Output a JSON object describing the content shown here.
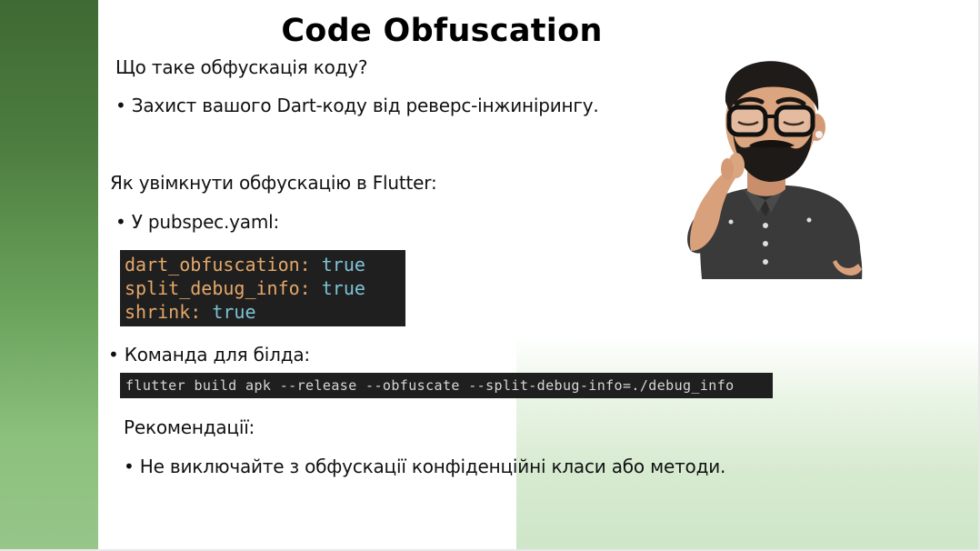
{
  "slide": {
    "title": "Code Obfuscation",
    "question": "Що таке обфускація коду?",
    "bullet_protection": "• Захист вашого Dart-коду від реверс-інжинірингу.",
    "how_to_heading": "Як увімкнути обфускацію в Flutter:",
    "bullet_pubspec": "• У pubspec.yaml:",
    "pubspec_code": [
      {
        "key": "dart_obfuscation:",
        "value": "true"
      },
      {
        "key": "split_debug_info:",
        "value": "true"
      },
      {
        "key": "shrink:",
        "value": "true"
      }
    ],
    "bullet_build_command": "• Команда для білда:",
    "build_command": "flutter build apk --release --obfuscate --split-debug-info=./debug_info",
    "recommendations_heading": "Рекомендації:",
    "bullet_recommendation": "• Не виключайте з обфускації конфіденційні класи або методи."
  },
  "colors": {
    "band_dark": "#3f6a33",
    "band_light": "#96c689",
    "code_bg": "#1f1f1f",
    "code_key": "#e5a76a",
    "code_value": "#7cc3d4"
  },
  "icons": {
    "avatar": "thinking-avatar-illustration"
  }
}
